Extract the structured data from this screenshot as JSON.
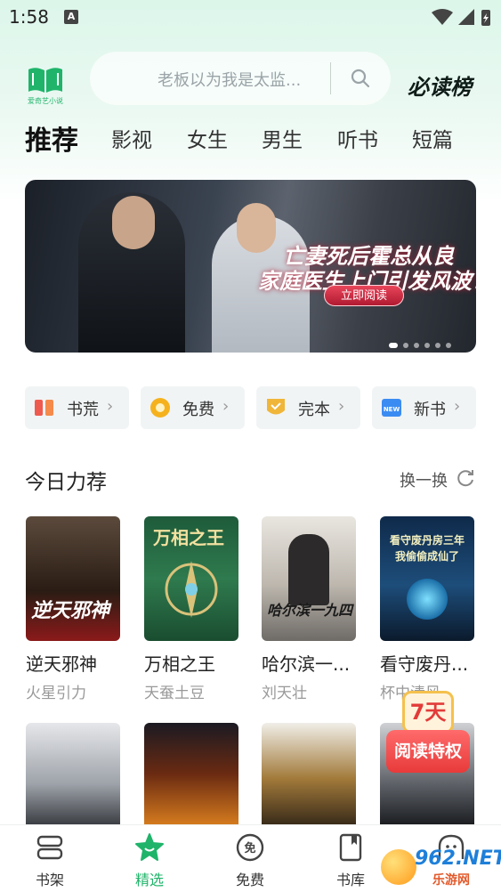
{
  "status_bar": {
    "time": "1:58",
    "notif": "A"
  },
  "logo": {
    "name": "爱奇艺小说"
  },
  "search": {
    "placeholder": "老板以为我是太监..."
  },
  "ranking": {
    "label": "必读榜"
  },
  "tabs": [
    {
      "label": "推荐",
      "active": true
    },
    {
      "label": "影视"
    },
    {
      "label": "女生"
    },
    {
      "label": "男生"
    },
    {
      "label": "听书"
    },
    {
      "label": "短篇"
    }
  ],
  "banner": {
    "line1": "亡妻死后霍总从良",
    "line2": "家庭医生上门引发风波！",
    "button": "立即阅读",
    "slides": 6,
    "active_slide": 1
  },
  "categories": [
    {
      "label": "书荒",
      "icon": "book-shortage-icon",
      "color": "#ef5a4f"
    },
    {
      "label": "免费",
      "icon": "coin-icon",
      "color": "#f5b21e"
    },
    {
      "label": "完本",
      "icon": "complete-shield-icon",
      "color": "#f0b63a"
    },
    {
      "label": "新书",
      "icon": "new-book-icon",
      "color": "#3b8cf2"
    }
  ],
  "section": {
    "title": "今日力荐",
    "refresh": "换一换"
  },
  "books": [
    {
      "title": "逆天邪神",
      "author": "火星引力",
      "cover_text": "逆天邪神"
    },
    {
      "title": "万相之王",
      "author": "天蚕土豆",
      "cover_text": "万相之王"
    },
    {
      "title": "哈尔滨一...",
      "author": "刘天壮",
      "cover_text": "哈尔滨一九四"
    },
    {
      "title": "看守废丹...",
      "author": "杯中清风",
      "cover_text": "看守废丹房三年 我偷偷成仙了"
    }
  ],
  "promo": {
    "days": "7天",
    "label": "阅读特权"
  },
  "bottom_nav": [
    {
      "label": "书架",
      "icon": "bookshelf-icon"
    },
    {
      "label": "精选",
      "icon": "featured-star-icon",
      "active": true
    },
    {
      "label": "免费",
      "icon": "free-badge-icon"
    },
    {
      "label": "书库",
      "icon": "library-icon"
    },
    {
      "label": "",
      "icon": "profile-icon"
    }
  ],
  "watermark": {
    "text": "962.NET",
    "sub": "乐游网"
  },
  "colors": {
    "accent": "#1fb46a",
    "promo_red": "#e83a3a"
  }
}
